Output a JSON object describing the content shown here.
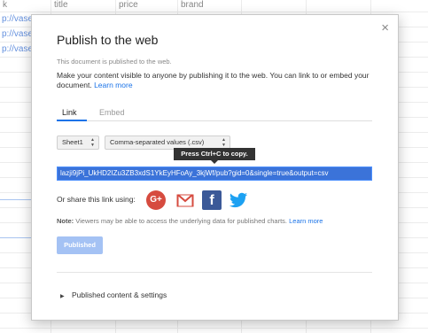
{
  "sheet": {
    "headers": [
      "k",
      "title",
      "price",
      "brand"
    ],
    "link_cells": [
      "p://vase",
      "p://vase",
      "p://vase"
    ]
  },
  "dialog": {
    "title": "Publish to the web",
    "close_glyph": "×",
    "status": "This document is published to the web.",
    "description": "Make your content visible to anyone by publishing it to the web. You can link to or embed your document.",
    "learn_more": "Learn more",
    "tabs": [
      {
        "label": "Link"
      },
      {
        "label": "Embed"
      }
    ],
    "sheet_select": "Sheet1",
    "format_select": "Comma-separated values (.csv)",
    "tooltip": "Press Ctrl+C to copy.",
    "url": "lazji9jPi_UkHD2IZu3ZB3xdS1YkEyHFoAy_3kjWf/pub?gid=0&single=true&output=csv",
    "share_label": "Or share this link using:",
    "social": {
      "gplus": "G+",
      "facebook": "f"
    },
    "note_label": "Note:",
    "note_text": "Viewers may be able to access the underlying data for published charts.",
    "note_link": "Learn more",
    "published_button": "Published",
    "expander_label": "Published content & settings",
    "expander_caret": "▶"
  },
  "colors": {
    "accent": "#1a73e8",
    "gplus": "#d64b3f",
    "facebook": "#3b5998",
    "twitter": "#1da1f2",
    "published_button": "#a4c2f4"
  },
  "icons": [
    "close-icon",
    "gplus-icon",
    "gmail-icon",
    "facebook-icon",
    "twitter-icon",
    "caret-right-icon"
  ]
}
